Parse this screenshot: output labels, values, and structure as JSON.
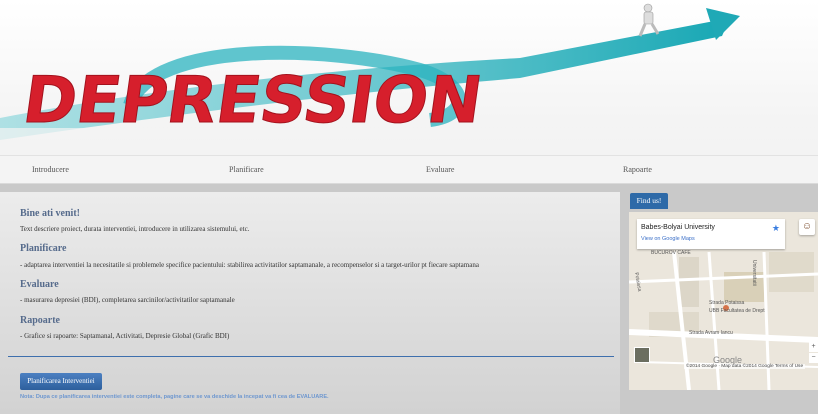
{
  "nav": [
    "Introducere",
    "Planificare",
    "Evaluare",
    "Rapoarte"
  ],
  "sections": [
    {
      "title": "Bine ati venit!",
      "text": "Text descriere proiect, durata interventiei, introducere in utilizarea sistemului, etc."
    },
    {
      "title": "Planificare",
      "text": "- adaptarea interventiei la necesitatile si problemele specifice pacientului: stabilirea activitatilor saptamanale, a recompenselor si a target-urilor pt fiecare saptamana"
    },
    {
      "title": "Evaluare",
      "text": "- masurarea depresiei (BDI), completarea sarcinilor/activitatilor saptamanale"
    },
    {
      "title": "Rapoarte",
      "text": "- Grafice si rapoarte: Saptamanal, Activitati, Depresie Global (Grafic BDI)"
    }
  ],
  "button_label": "Planificarea Interventiei",
  "note": "Nota: Dupa ce planificarea interventiei este completa, pagine care se va deschide la incepat va fi cea de EVALUARE.",
  "sidebar": {
    "tab": "Find us!",
    "map": {
      "place_name": "Babes-Bolyai University",
      "view_link": "View on Google Maps",
      "star": "★",
      "avatar": "☺",
      "labels": [
        "BUCUROV CAFE",
        "Strada Potaissa",
        "UBB Facultatea de Drept",
        "Strada Avram Iancu",
        "Universitatii",
        "Potaissa"
      ],
      "zoom_in": "+",
      "zoom_out": "−",
      "logo": "Google",
      "footer": "©2014 Google · Map data ©2014 Google   Terms of Use"
    }
  },
  "banner": {
    "word": "DEPRESSION"
  },
  "colors": {
    "accent": "#2e6aa8",
    "title": "#566b8c",
    "rule": "#3e6fad",
    "banner_red": "#d61f2c",
    "banner_teal": "#2bb3bf"
  }
}
